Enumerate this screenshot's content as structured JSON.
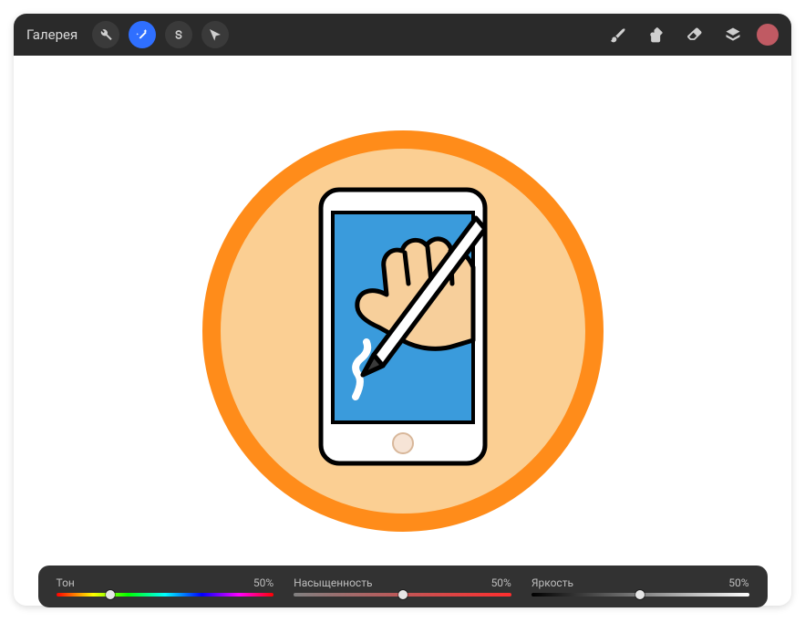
{
  "topbar": {
    "gallery_label": "Галерея"
  },
  "icons": {
    "wrench": "wrench-icon",
    "wand": "wand-icon",
    "s_shape": "s-shape-icon",
    "arrow": "arrow-icon",
    "brush_paint": "paintbrush-icon",
    "smudge": "smudge-icon",
    "eraser": "eraser-icon",
    "layers": "layers-icon",
    "color": "color-circle"
  },
  "color_swatch": "#c05a63",
  "sliders": {
    "hue": {
      "label": "Тон",
      "value_text": "50%",
      "value_pct": 25
    },
    "saturation": {
      "label": "Насыщенность",
      "value_text": "50%",
      "value_pct": 50
    },
    "brightness": {
      "label": "Яркость",
      "value_text": "50%",
      "value_pct": 50
    }
  }
}
